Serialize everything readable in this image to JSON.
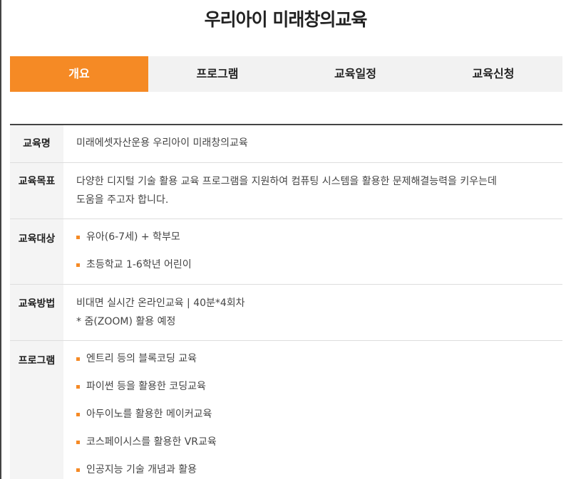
{
  "page": {
    "title": "우리아이 미래창의교육"
  },
  "tabs": [
    {
      "label": "개요",
      "active": true
    },
    {
      "label": "프로그램",
      "active": false
    },
    {
      "label": "교육일정",
      "active": false
    },
    {
      "label": "교육신청",
      "active": false
    }
  ],
  "colors": {
    "accent": "#f58a25",
    "tab_background": "#f2f2f2",
    "label_background": "#f4f4f4"
  },
  "info": {
    "name": {
      "label": "교육명",
      "value": "미래에셋자산운용 우리아이 미래창의교육"
    },
    "goal": {
      "label": "교육목표",
      "lines": [
        "다양한 디지털 기술 활용 교육 프로그램을 지원하여 컴퓨팅 시스템을 활용한 문제해결능력을 키우는데",
        "도움을 주고자 합니다."
      ]
    },
    "target": {
      "label": "교육대상",
      "items": [
        "유아(6-7세) + 학부모",
        "초등학교 1-6학년 어린이"
      ]
    },
    "method": {
      "label": "교육방법",
      "lines": [
        "비대면 실시간 온라인교육 | 40분*4회차",
        "* 줌(ZOOM) 활용 예정"
      ]
    },
    "program": {
      "label": "프로그램",
      "items": [
        "엔트리 등의 블록코딩 교육",
        "파이썬 등을 활용한 코딩교육",
        "아두이노를 활용한 메이커교육",
        "코스페이시스를 활용한 VR교육",
        "인공지능 기술 개념과 활용"
      ]
    }
  }
}
